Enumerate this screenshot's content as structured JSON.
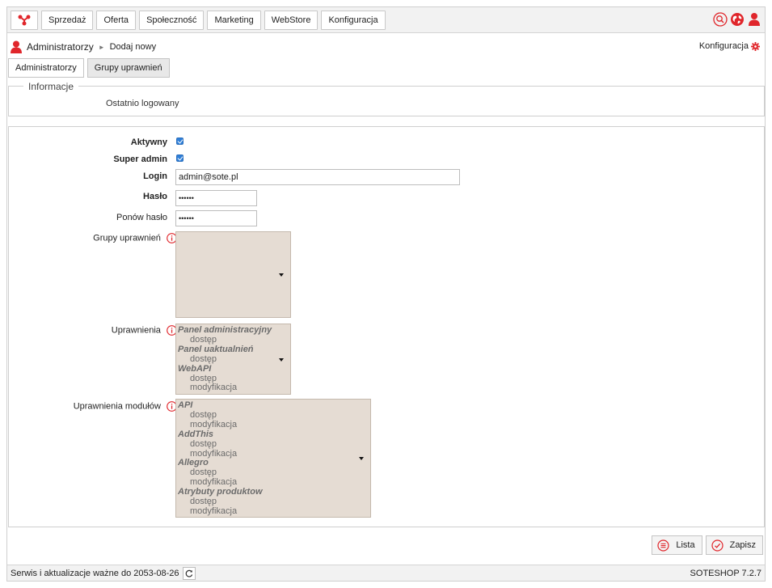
{
  "nav": {
    "items": [
      "Sprzedaż",
      "Oferta",
      "Społeczność",
      "Marketing",
      "WebStore",
      "Konfiguracja"
    ]
  },
  "breadcrumb": {
    "title": "Administratorzy",
    "separator": "►",
    "current": "Dodaj nowy"
  },
  "config_link": "Konfiguracja",
  "tabs": [
    "Administratorzy",
    "Grupy uprawnień"
  ],
  "info": {
    "legend": "Informacje",
    "last_login_label": "Ostatnio logowany"
  },
  "form": {
    "active_label": "Aktywny",
    "super_admin_label": "Super admin",
    "login_label": "Login",
    "login_value": "admin@sote.pl",
    "password_label": "Hasło",
    "password_value": "••••••",
    "repeat_password_label": "Ponów hasło",
    "repeat_password_value": "••••••",
    "groups_label": "Grupy uprawnień",
    "permissions_label": "Uprawnienia",
    "permissions": [
      {
        "group": "Panel administracyjny",
        "options": [
          "dostęp"
        ]
      },
      {
        "group": "Panel uaktualnień",
        "options": [
          "dostęp"
        ]
      },
      {
        "group": "WebAPI",
        "options": [
          "dostęp",
          "modyfikacja"
        ]
      }
    ],
    "module_permissions_label": "Uprawnienia modułów",
    "module_permissions": [
      {
        "group": "API",
        "options": [
          "dostęp",
          "modyfikacja"
        ]
      },
      {
        "group": "AddThis",
        "options": [
          "dostęp",
          "modyfikacja"
        ]
      },
      {
        "group": "Allegro",
        "options": [
          "dostęp",
          "modyfikacja"
        ]
      },
      {
        "group": "Atrybuty produktow",
        "options": [
          "dostęp",
          "modyfikacja"
        ]
      }
    ]
  },
  "actions": {
    "list_label": "Lista",
    "save_label": "Zapisz"
  },
  "footer": {
    "service_text": "Serwis i aktualizacje ważne do 2053-08-26",
    "version": "SOTESHOP 7.2.7"
  },
  "colors": {
    "accent": "#e0262b",
    "select_bg": "#e5dcd3",
    "checkbox": "#2f7fd8"
  }
}
